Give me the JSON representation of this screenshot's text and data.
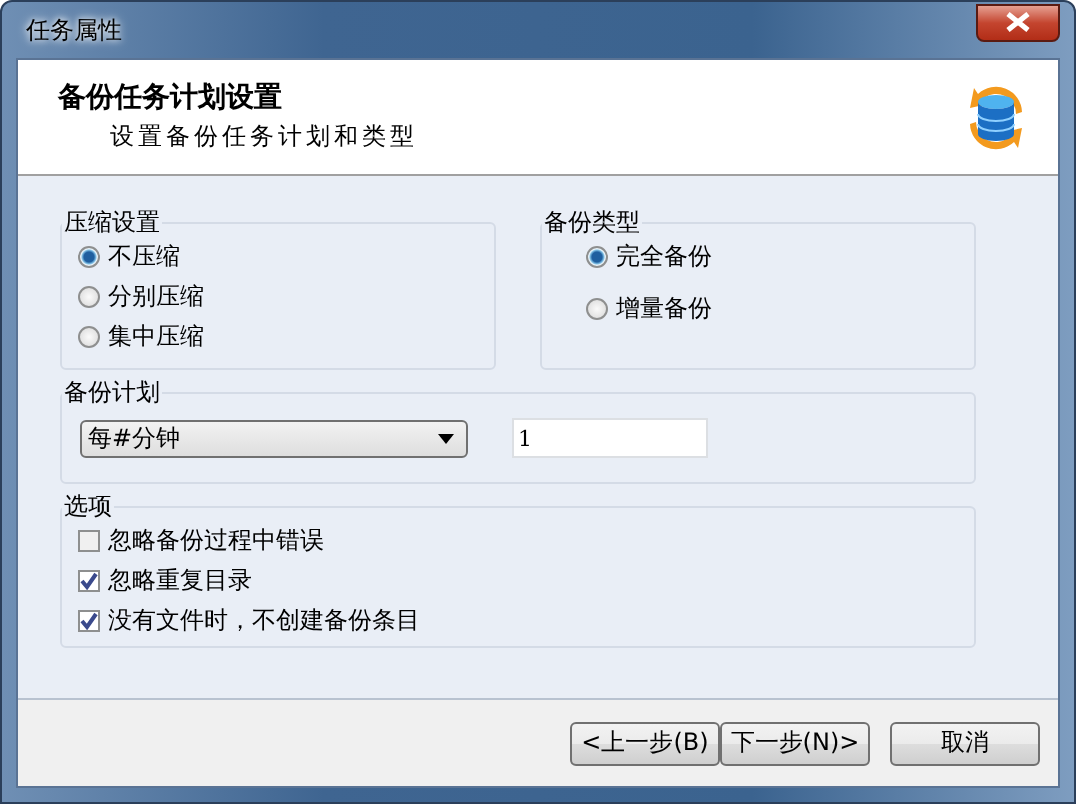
{
  "window": {
    "title": "任务属性"
  },
  "header": {
    "title": "备份任务计划设置",
    "subtitle": "设置备份任务计划和类型"
  },
  "compression": {
    "title": "压缩设置",
    "options": [
      {
        "label": "不压缩",
        "selected": true
      },
      {
        "label": "分别压缩",
        "selected": false
      },
      {
        "label": "集中压缩",
        "selected": false
      }
    ]
  },
  "backup_type": {
    "title": "备份类型",
    "options": [
      {
        "label": "完全备份",
        "selected": true
      },
      {
        "label": "增量备份",
        "selected": false
      }
    ]
  },
  "schedule": {
    "title": "备份计划",
    "dropdown": "每#分钟",
    "value": "1"
  },
  "options": {
    "title": "选项",
    "items": [
      {
        "label": "忽略备份过程中错误",
        "checked": false
      },
      {
        "label": "忽略重复目录",
        "checked": true
      },
      {
        "label": "没有文件时，不创建备份条目",
        "checked": true
      }
    ]
  },
  "buttons": [
    {
      "label": "<上一步(B)",
      "kind": "back"
    },
    {
      "label": "下一步(N)>",
      "kind": "next"
    },
    {
      "label": "取消",
      "kind": "cancel"
    }
  ]
}
